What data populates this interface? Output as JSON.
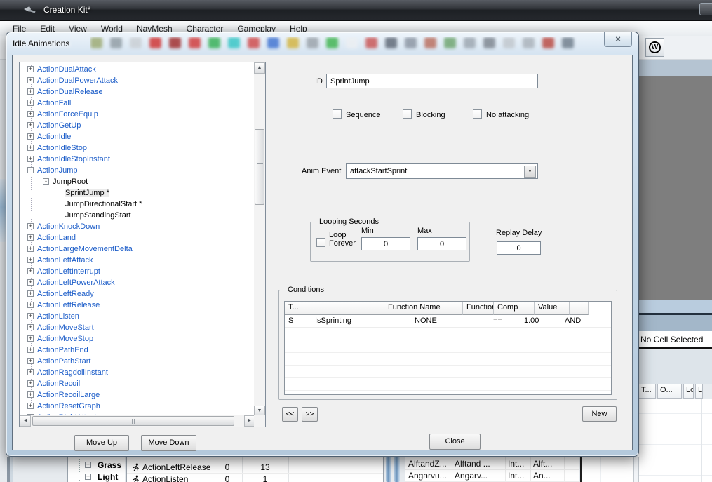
{
  "icons": {
    "close": "×",
    "w_logo": "W",
    "up": "▲",
    "down": "▼",
    "left": "◄",
    "right": "►",
    "dropdown": "▼",
    "expand": "+",
    "collapse": "-"
  },
  "main_window": {
    "title": "Creation Kit*",
    "menu": [
      "File",
      "Edit",
      "View",
      "World",
      "NavMesh",
      "Character",
      "Gameplay",
      "Help"
    ],
    "toolbar_blob_colors": [
      "#9aa86e",
      "#8e9aa2",
      "#c9ced3",
      "#cf2b2b",
      "#9e2424",
      "#d03434",
      "#2fae4f",
      "#2fc4c4",
      "#cf4444",
      "#3a6fd0",
      "#d3b23a",
      "#98a0a8",
      "#39b24a",
      "#eceff2",
      "#c85050",
      "#5a6472",
      "#8892a0",
      "#b86a5a",
      "#6aa26a",
      "#9aa4ae",
      "#7a828c",
      "#c0c6cc",
      "#a8b0b8",
      "#b8443c",
      "#6c7a88"
    ],
    "cell_view": {
      "no_cell_label": "No Cell Selected",
      "columns": [
        "T...",
        "O...",
        "Loc...",
        "L"
      ],
      "rows": [
        {
          "c0": "AlftandZ...",
          "c1": "Alftand ...",
          "c2": "Int...",
          "c3": "Alft..."
        },
        {
          "c0": "Angarvu...",
          "c1": "Angarv...",
          "c2": "Int...",
          "c3": "An..."
        }
      ]
    },
    "object_window": {
      "items": [
        {
          "label": "Grass"
        },
        {
          "label": "Light"
        }
      ]
    },
    "anim_list": {
      "rows": [
        {
          "name": "ActionLeftRelease",
          "c1": "0",
          "c2": "13"
        },
        {
          "name": "ActionListen",
          "c1": "0",
          "c2": "1"
        }
      ]
    }
  },
  "dialog": {
    "title": "Idle Animations",
    "tree": {
      "items": [
        {
          "label": "ActionDualAttack",
          "glyph": "+",
          "cls": "lv0 blue"
        },
        {
          "label": "ActionDualPowerAttack",
          "glyph": "+",
          "cls": "lv0 blue"
        },
        {
          "label": "ActionDualRelease",
          "glyph": "+",
          "cls": "lv0 blue"
        },
        {
          "label": "ActionFall",
          "glyph": "+",
          "cls": "lv0 blue"
        },
        {
          "label": "ActionForceEquip",
          "glyph": "+",
          "cls": "lv0 blue"
        },
        {
          "label": "ActionGetUp",
          "glyph": "+",
          "cls": "lv0 blue"
        },
        {
          "label": "ActionIdle",
          "glyph": "+",
          "cls": "lv0 blue"
        },
        {
          "label": "ActionIdleStop",
          "glyph": "+",
          "cls": "lv0 blue"
        },
        {
          "label": "ActionIdleStopInstant",
          "glyph": "+",
          "cls": "lv0 blue"
        },
        {
          "label": "ActionJump",
          "glyph": "-",
          "cls": "lv0 blue"
        },
        {
          "label": "JumpRoot",
          "glyph": "-",
          "cls": "lv1 black"
        },
        {
          "label": "SprintJump *",
          "glyph": "",
          "cls": "lv2 black sel"
        },
        {
          "label": "JumpDirectionalStart *",
          "glyph": "",
          "cls": "lv2 black"
        },
        {
          "label": "JumpStandingStart",
          "glyph": "",
          "cls": "lv2 black"
        },
        {
          "label": "ActionKnockDown",
          "glyph": "+",
          "cls": "lv0 blue"
        },
        {
          "label": "ActionLand",
          "glyph": "+",
          "cls": "lv0 blue"
        },
        {
          "label": "ActionLargeMovementDelta",
          "glyph": "+",
          "cls": "lv0 blue"
        },
        {
          "label": "ActionLeftAttack",
          "glyph": "+",
          "cls": "lv0 blue"
        },
        {
          "label": "ActionLeftInterrupt",
          "glyph": "+",
          "cls": "lv0 blue"
        },
        {
          "label": "ActionLeftPowerAttack",
          "glyph": "+",
          "cls": "lv0 blue"
        },
        {
          "label": "ActionLeftReady",
          "glyph": "+",
          "cls": "lv0 blue"
        },
        {
          "label": "ActionLeftRelease",
          "glyph": "+",
          "cls": "lv0 blue"
        },
        {
          "label": "ActionListen",
          "glyph": "+",
          "cls": "lv0 blue"
        },
        {
          "label": "ActionMoveStart",
          "glyph": "+",
          "cls": "lv0 blue"
        },
        {
          "label": "ActionMoveStop",
          "glyph": "+",
          "cls": "lv0 blue"
        },
        {
          "label": "ActionPathEnd",
          "glyph": "+",
          "cls": "lv0 blue"
        },
        {
          "label": "ActionPathStart",
          "glyph": "+",
          "cls": "lv0 blue"
        },
        {
          "label": "ActionRagdollInstant",
          "glyph": "+",
          "cls": "lv0 blue"
        },
        {
          "label": "ActionRecoil",
          "glyph": "+",
          "cls": "lv0 blue"
        },
        {
          "label": "ActionRecoilLarge",
          "glyph": "+",
          "cls": "lv0 blue"
        },
        {
          "label": "ActionResetGraph",
          "glyph": "+",
          "cls": "lv0 blue"
        },
        {
          "label": "ActionRightAttack",
          "glyph": "+",
          "cls": "lv0 blue"
        }
      ]
    },
    "id_field": {
      "label": "ID",
      "value": "SprintJump"
    },
    "checkboxes": {
      "sequence": "Sequence",
      "blocking": "Blocking",
      "no_attacking": "No attacking"
    },
    "anim_event": {
      "label": "Anim Event",
      "value": "attackStartSprint"
    },
    "looping": {
      "caption": "Looping Seconds",
      "loop_forever": "Loop Forever",
      "min_label": "Min",
      "max_label": "Max",
      "min_value": "0",
      "max_value": "0"
    },
    "replay_delay": {
      "label": "Replay Delay",
      "value": "0"
    },
    "conditions": {
      "caption": "Conditions",
      "columns": [
        "T...",
        "Function Name",
        "Function Info",
        "Comp",
        "Value",
        "",
        ""
      ],
      "row": {
        "t": "S",
        "fn": "IsSprinting",
        "fi": "NONE",
        "comp": "==",
        "val": "1.00",
        "andor": "AND"
      }
    },
    "buttons": {
      "prev": "<<",
      "next": ">>",
      "new": "New",
      "close": "Close",
      "move_up": "Move Up",
      "move_down": "Move Down"
    }
  }
}
